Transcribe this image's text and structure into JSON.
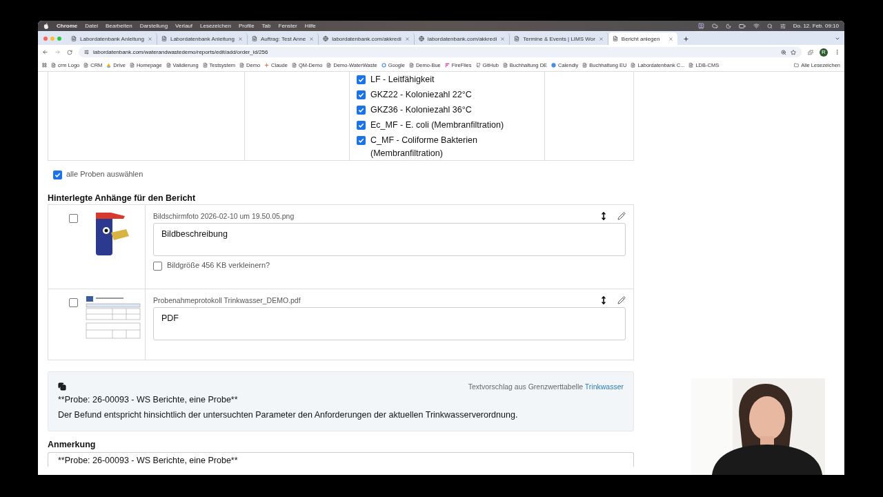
{
  "menubar": {
    "app": "Chrome",
    "items": [
      "Datei",
      "Bearbeiten",
      "Darstellung",
      "Verlauf",
      "Lesezeichen",
      "Profile",
      "Tab",
      "Fenster",
      "Hilfe"
    ],
    "clock": "Do. 12. Feb. 09:10"
  },
  "tabs": [
    {
      "title": "Labordatenbank Anleitung",
      "kind": "doc",
      "selected": false
    },
    {
      "title": "Labordatenbank Anleitung",
      "kind": "doc",
      "selected": false
    },
    {
      "title": "Auftrag: Test Anne",
      "kind": "doc",
      "selected": false
    },
    {
      "title": "labordatenbank.com/akkredi",
      "kind": "globe",
      "selected": false
    },
    {
      "title": "labordatenbank.com/akkredi",
      "kind": "globe",
      "selected": false
    },
    {
      "title": "Termine & Events | LIMS Wor",
      "kind": "doc",
      "selected": false
    },
    {
      "title": "Bericht anlegen",
      "kind": "doc",
      "selected": true
    }
  ],
  "address": "labordatenbank.com/waterandwastedemo/reports/edit/add/order_id/256",
  "profile_initial": "R",
  "bookmarks": [
    {
      "label": "crm Logo",
      "kind": "doc"
    },
    {
      "label": "CRM",
      "kind": "doc"
    },
    {
      "label": "Drive",
      "kind": "drive"
    },
    {
      "label": "Homepage",
      "kind": "doc"
    },
    {
      "label": "Validierung",
      "kind": "doc"
    },
    {
      "label": "Testsystem",
      "kind": "doc"
    },
    {
      "label": "Demo",
      "kind": "doc"
    },
    {
      "label": "Claude",
      "kind": "star"
    },
    {
      "label": "QM-Demo",
      "kind": "doc"
    },
    {
      "label": "Demo-WaterWaste",
      "kind": "doc"
    },
    {
      "label": "Google",
      "kind": "g"
    },
    {
      "label": "Demo-Bue",
      "kind": "doc"
    },
    {
      "label": "FireFlies",
      "kind": "ff"
    },
    {
      "label": "GitHub",
      "kind": "gh"
    },
    {
      "label": "Buchhaltung DE",
      "kind": "doc"
    },
    {
      "label": "Calendly",
      "kind": "dot"
    },
    {
      "label": "Buchhaltung EU",
      "kind": "doc"
    },
    {
      "label": "Labordatenbank C...",
      "kind": "doc"
    },
    {
      "label": "LDB-CMS",
      "kind": "doc"
    }
  ],
  "all_bookmarks": "Alle Lesezeichen",
  "parameters": [
    {
      "label": "LF - Leitfähigkeit",
      "checked": true
    },
    {
      "label": "GKZ22 - Koloniezahl 22°C",
      "checked": true
    },
    {
      "label": "GKZ36 - Koloniezahl 36°C",
      "checked": true
    },
    {
      "label": "Ec_MF - E. coli (Membranfiltration)",
      "checked": true
    },
    {
      "label": "C_MF - Coliforme Bakterien (Membranfiltration)",
      "checked": true
    }
  ],
  "select_all": {
    "label": "alle Proben auswählen",
    "checked": true
  },
  "attachments_heading": "Hinterlegte Anhänge für den Bericht",
  "attachments": [
    {
      "checked": false,
      "filename": "Bildschirmfoto 2026-02-10 um 19.50.05.png",
      "description": "Bildbeschreibung",
      "resize": {
        "label": "Bildgröße 456 KB verkleinern?",
        "checked": false
      }
    },
    {
      "kind": "pdf",
      "checked": false,
      "filename": "Probenahmeprotokoll Trinkwasser_DEMO.pdf",
      "description": "PDF"
    }
  ],
  "suggestion": {
    "source": "Textvorschlag aus Grenzwerttabelle",
    "link": "Trinkwasser",
    "lines": [
      "**Probe: 26-00093 - WS Berichte, eine Probe**",
      "Der Befund entspricht hinsichtlich der untersuchten Parameter den Anforderungen der aktuellen Trinkwasserverordnung."
    ]
  },
  "remark": {
    "heading": "Anmerkung",
    "value": "**Probe: 26-00093 - WS Berichte, eine Probe**"
  }
}
